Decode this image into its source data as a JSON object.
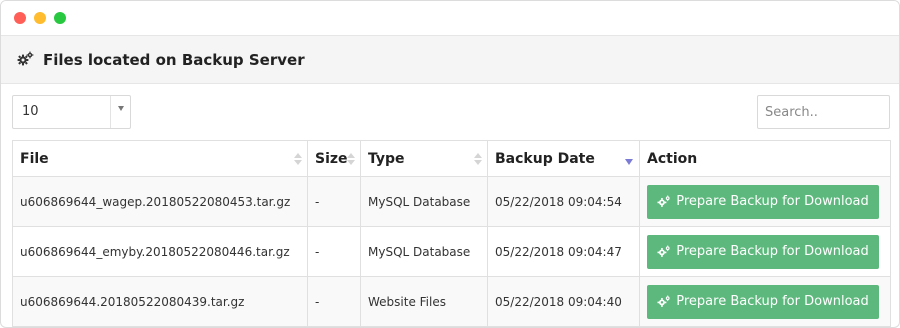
{
  "panel": {
    "title": "Files located on Backup Server",
    "icon": "cogs-icon"
  },
  "length_select": {
    "value": "10"
  },
  "search": {
    "placeholder": "Search.."
  },
  "table": {
    "headers": {
      "file": "File",
      "size": "Size",
      "type": "Type",
      "backup_date": "Backup Date",
      "action": "Action"
    },
    "sorted_column": "backup_date",
    "sort_direction": "desc",
    "rows": [
      {
        "file": "u606869644_wagep.20180522080453.tar.gz",
        "size": "-",
        "type": "MySQL Database",
        "backup_date": "05/22/2018 09:04:54",
        "action": "Prepare Backup for Download"
      },
      {
        "file": "u606869644_emyby.20180522080446.tar.gz",
        "size": "-",
        "type": "MySQL Database",
        "backup_date": "05/22/2018 09:04:47",
        "action": "Prepare Backup for Download"
      },
      {
        "file": "u606869644.20180522080439.tar.gz",
        "size": "-",
        "type": "Website Files",
        "backup_date": "05/22/2018 09:04:40",
        "action": "Prepare Backup for Download"
      }
    ]
  },
  "colors": {
    "button": "#5cb87c",
    "sort_active": "#7b7bd6",
    "window_close": "#ff5f57",
    "window_minimize": "#febc2e",
    "window_zoom": "#28c840"
  }
}
